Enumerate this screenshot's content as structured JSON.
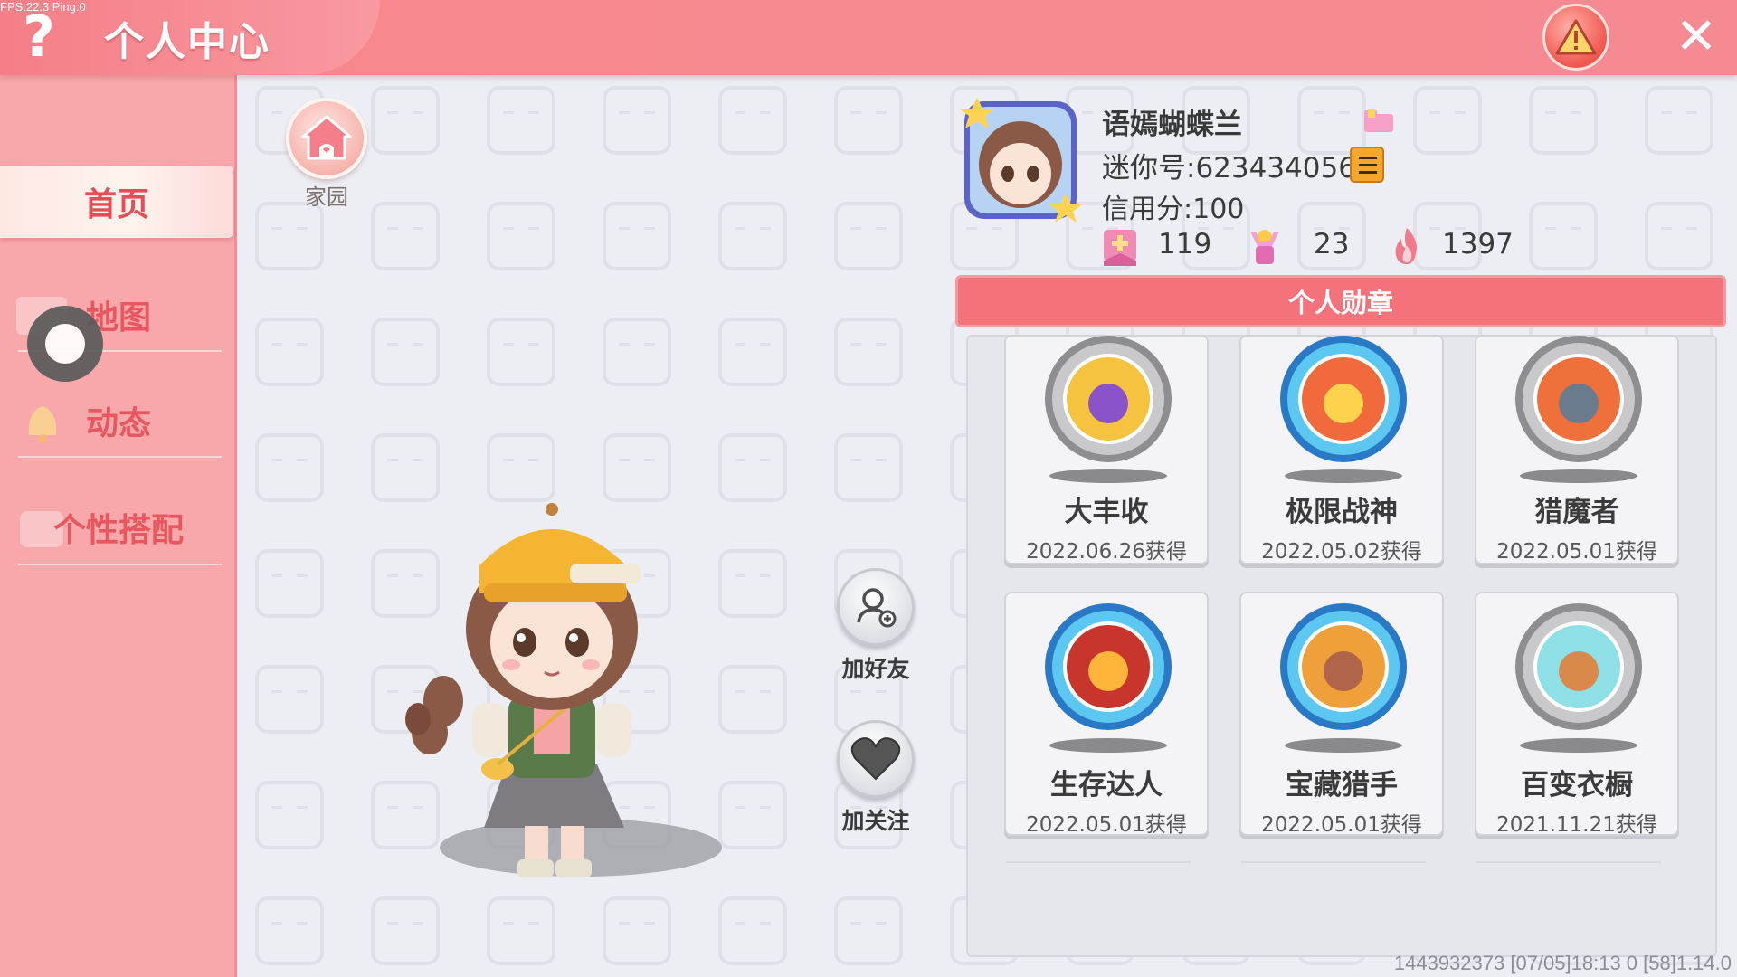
{
  "debug": {
    "fps_text": "FPS:22.3  Ping:0"
  },
  "header": {
    "title": "个人中心",
    "help_label": "?",
    "close_label": "✕"
  },
  "sidebar": {
    "items": [
      {
        "label": "首页",
        "active": true
      },
      {
        "label": "地图",
        "active": false
      },
      {
        "label": "动态",
        "active": false
      },
      {
        "label": "个性搭配",
        "active": false
      }
    ]
  },
  "home": {
    "label": "家园"
  },
  "actions": {
    "add_friend": "加好友",
    "follow": "加关注"
  },
  "profile": {
    "name": "语嫣蝴蝶兰",
    "mini_id": "迷你号:623434056",
    "credit": "信用分:100",
    "stats": [
      {
        "icon": "flower-gift-icon",
        "value": "119"
      },
      {
        "icon": "trophy-person-icon",
        "value": "23"
      },
      {
        "icon": "flame-icon",
        "value": "1397"
      }
    ]
  },
  "medals": {
    "title": "个人勋章",
    "items": [
      {
        "name": "大丰收",
        "date": "2022.06.26获得",
        "icon": "harvest-medal-icon"
      },
      {
        "name": "极限战神",
        "date": "2022.05.02获得",
        "icon": "boss-medal-icon"
      },
      {
        "name": "猎魔者",
        "date": "2022.05.01获得",
        "icon": "demon-hunter-medal-icon"
      },
      {
        "name": "生存达人",
        "date": "2022.05.01获得",
        "icon": "campfire-medal-icon"
      },
      {
        "name": "宝藏猎手",
        "date": "2022.05.01获得",
        "icon": "treasure-medal-icon"
      },
      {
        "name": "百变衣橱",
        "date": "2021.11.21获得",
        "icon": "wardrobe-medal-icon"
      }
    ]
  },
  "footer": {
    "info": "1443932373   [07/05]18:13 0   [58]1.14.0"
  },
  "colors": {
    "primary": "#f4737b",
    "sidebar": "#f8a7aa",
    "background": "#eceef4"
  }
}
